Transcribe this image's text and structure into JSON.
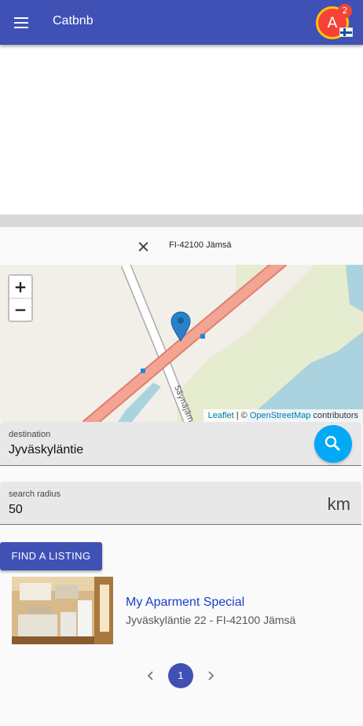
{
  "appbar": {
    "title": "Catbnb",
    "avatar_letter": "A",
    "notification_count": "2",
    "language_flag": "finland-flag-icon",
    "color": "#3f51b5"
  },
  "location_bar": {
    "clear_icon": "close-icon",
    "text": "FI-42100 Jämsä"
  },
  "map": {
    "zoom_in_label": "+",
    "zoom_out_label": "−",
    "street_label": "Säynäjämäntie",
    "attribution_leaflet": "Leaflet",
    "attribution_sep": " | © ",
    "attribution_osm": "OpenStreetMap",
    "attribution_suffix": " contributors",
    "marker_icon": "map-marker-icon"
  },
  "destination": {
    "label": "destination",
    "value": "Jyväskyläntie",
    "search_icon": "search-icon",
    "search_color": "#03a9f4"
  },
  "radius": {
    "label": "search radius",
    "value": "50",
    "unit": "km"
  },
  "find_button": {
    "label": "FIND A LISTING"
  },
  "listings": [
    {
      "title": "My Aparment Special",
      "address": "Jyväskyläntie 22 - FI-42100 Jämsä",
      "thumbnail": "kitchen-photo"
    }
  ],
  "pagination": {
    "prev_icon": "chevron-left-icon",
    "current_page": "1",
    "next_icon": "chevron-right-icon"
  }
}
